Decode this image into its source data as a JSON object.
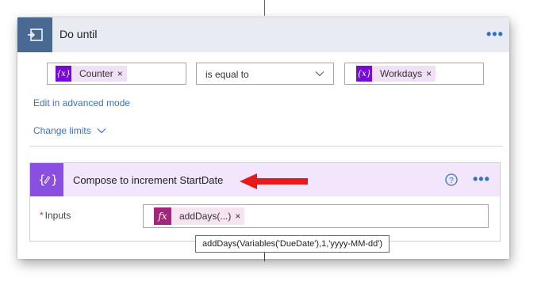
{
  "loop": {
    "title": "Do until",
    "icon": "loop-icon",
    "menu_icon": "more-options-icon",
    "condition": {
      "left_token": "Counter",
      "operator": "is equal to",
      "right_token": "Workdays",
      "variable_icon_glyph": "{x}",
      "remove_glyph": "×"
    },
    "advanced_link": "Edit in advanced mode",
    "limits_link": "Change limits"
  },
  "action": {
    "title": "Compose to increment StartDate",
    "icon": "compose-icon",
    "help_icon": "help-icon",
    "menu_icon": "more-options-icon",
    "inputs_label": "Inputs",
    "required_marker": "*",
    "expression_token": "addDays(...)",
    "expression_icon_glyph": "fx",
    "remove_glyph": "×"
  },
  "tooltip": {
    "text": "addDays(Variables('DueDate'),1,'yyyy-MM-dd')"
  },
  "colors": {
    "loop_header_icon_bg": "#486991",
    "action_header_icon_bg": "#8a4ee0",
    "variable_token_icon": "#770bd6",
    "expression_token_icon": "#a4267c",
    "link": "#3a72c7",
    "annotation_arrow": "#e8191b"
  }
}
